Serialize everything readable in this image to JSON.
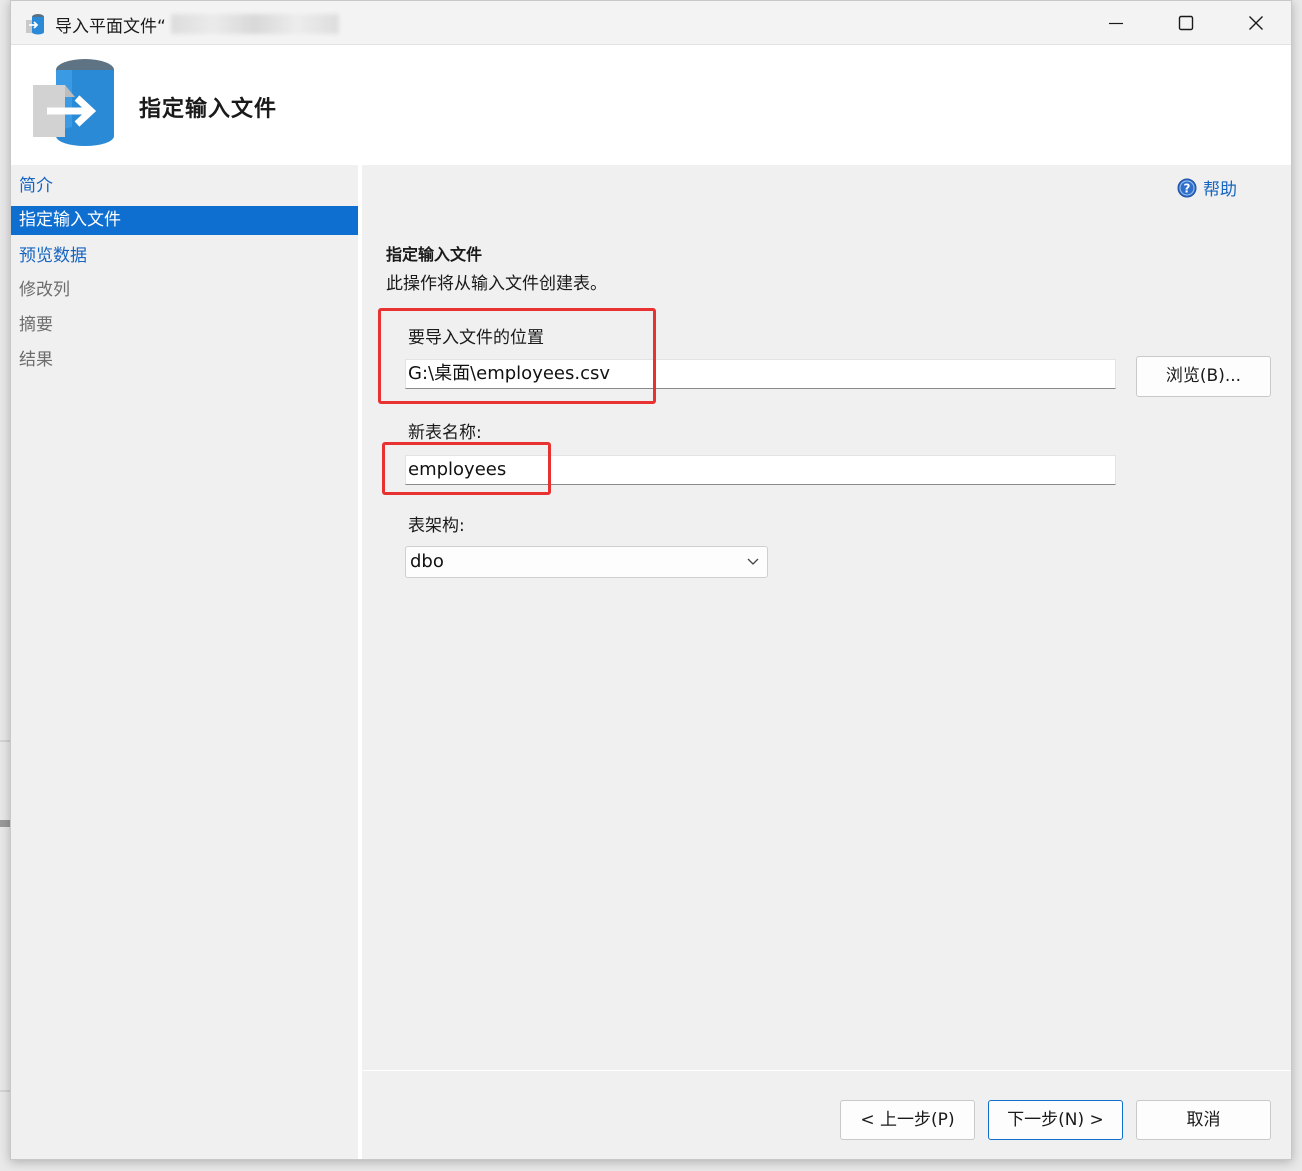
{
  "window": {
    "title": "导入平面文件“"
  },
  "header": {
    "title": "指定输入文件"
  },
  "nav": {
    "items": [
      {
        "label": "简介",
        "state": "link"
      },
      {
        "label": "指定输入文件",
        "state": "selected"
      },
      {
        "label": "预览数据",
        "state": "link"
      },
      {
        "label": "修改列",
        "state": "disabled"
      },
      {
        "label": "摘要",
        "state": "disabled"
      },
      {
        "label": "结果",
        "state": "disabled"
      }
    ]
  },
  "content": {
    "help_label": "帮助",
    "section_title": "指定输入文件",
    "section_desc": "此操作将从输入文件创建表。",
    "file_location_label": "要导入文件的位置",
    "file_location_value": "G:\\桌面\\employees.csv",
    "browse_label": "浏览(B)...",
    "table_name_label": "新表名称:",
    "table_name_value": "employees",
    "schema_label": "表架构:",
    "schema_value": "dbo"
  },
  "footer": {
    "prev_label": "< 上一步(P)",
    "next_label": "下一步(N) >",
    "cancel_label": "取消"
  },
  "colors": {
    "accent": "#0f6fd0",
    "link": "#1665c0",
    "highlight": "#e83232"
  },
  "icons": {
    "app": "import-flat-file-icon",
    "header": "database-import-icon",
    "help": "help-icon"
  }
}
